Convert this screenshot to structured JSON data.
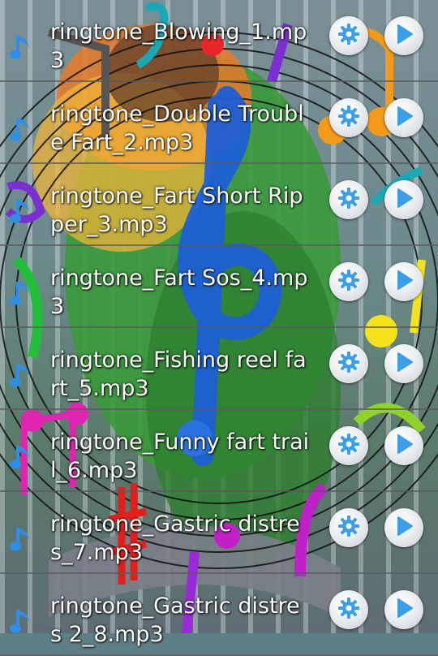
{
  "ringtones": [
    {
      "name": "ringtone_Blowing_1.mp3"
    },
    {
      "name": "ringtone_Double Trouble Fart_2.mp3"
    },
    {
      "name": "ringtone_Fart Short Ripper_3.mp3"
    },
    {
      "name": "ringtone_Fart Sos_4.mp3"
    },
    {
      "name": "ringtone_Fishing reel fart_5.mp3"
    },
    {
      "name": "ringtone_Funny fart trail_6.mp3"
    },
    {
      "name": "ringtone_Gastric distres_7.mp3"
    },
    {
      "name": "ringtone_Gastric distres 2_8.mp3"
    }
  ],
  "icons": {
    "row_icon": "music-note-icon",
    "settings": "gear-icon",
    "play": "play-icon"
  },
  "colors": {
    "note": "#2f8fe6",
    "button_icon": "#3d9ee8",
    "divider": "#5a5a5f"
  }
}
